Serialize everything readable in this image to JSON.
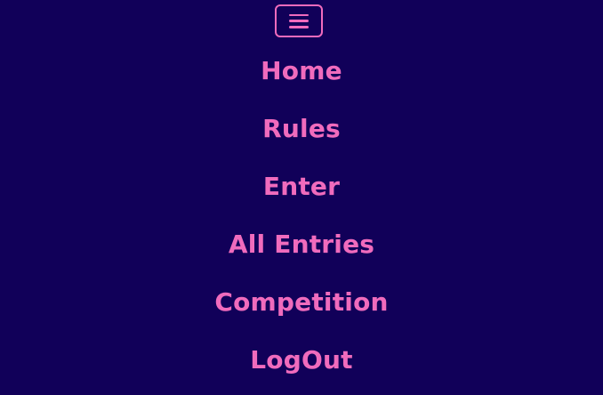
{
  "colors": {
    "background": "#110059",
    "accent": "#f06bbd"
  },
  "menu_toggle": {
    "icon": "hamburger-menu-icon"
  },
  "nav": {
    "items": [
      {
        "label": "Home"
      },
      {
        "label": "Rules"
      },
      {
        "label": "Enter"
      },
      {
        "label": "All Entries"
      },
      {
        "label": "Competition"
      },
      {
        "label": "LogOut"
      }
    ]
  }
}
